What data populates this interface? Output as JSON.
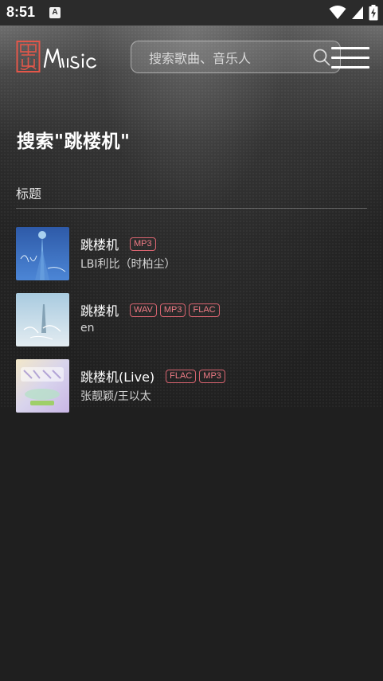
{
  "status_bar": {
    "time": "8:51",
    "notification_glyph": "A",
    "icons": [
      "wifi-icon",
      "cellular-signal-icon",
      "battery-charging-icon"
    ]
  },
  "header": {
    "logo_name": "黑山 Music logo",
    "search": {
      "placeholder": "搜索歌曲、音乐人",
      "value": ""
    },
    "icons": [
      "search-icon",
      "menu-icon"
    ]
  },
  "page_title": "搜索\"跳楼机\"",
  "list_header": "标题",
  "songs": [
    {
      "title": "跳楼机",
      "formats": [
        "MP3"
      ],
      "artist": "LBI利比（时柏尘）"
    },
    {
      "title": "跳楼机",
      "formats": [
        "WAV",
        "MP3",
        "FLAC"
      ],
      "artist": "en"
    },
    {
      "title": "跳楼机(Live)",
      "formats": [
        "FLAC",
        "MP3"
      ],
      "artist": "张靓颖/王以太"
    }
  ],
  "colors": {
    "background": "#1f1f1f",
    "status_bar": "#2b2b2b",
    "badge_border": "#d96470",
    "badge_text": "#f07c86",
    "logo_red": "#e4574a"
  }
}
